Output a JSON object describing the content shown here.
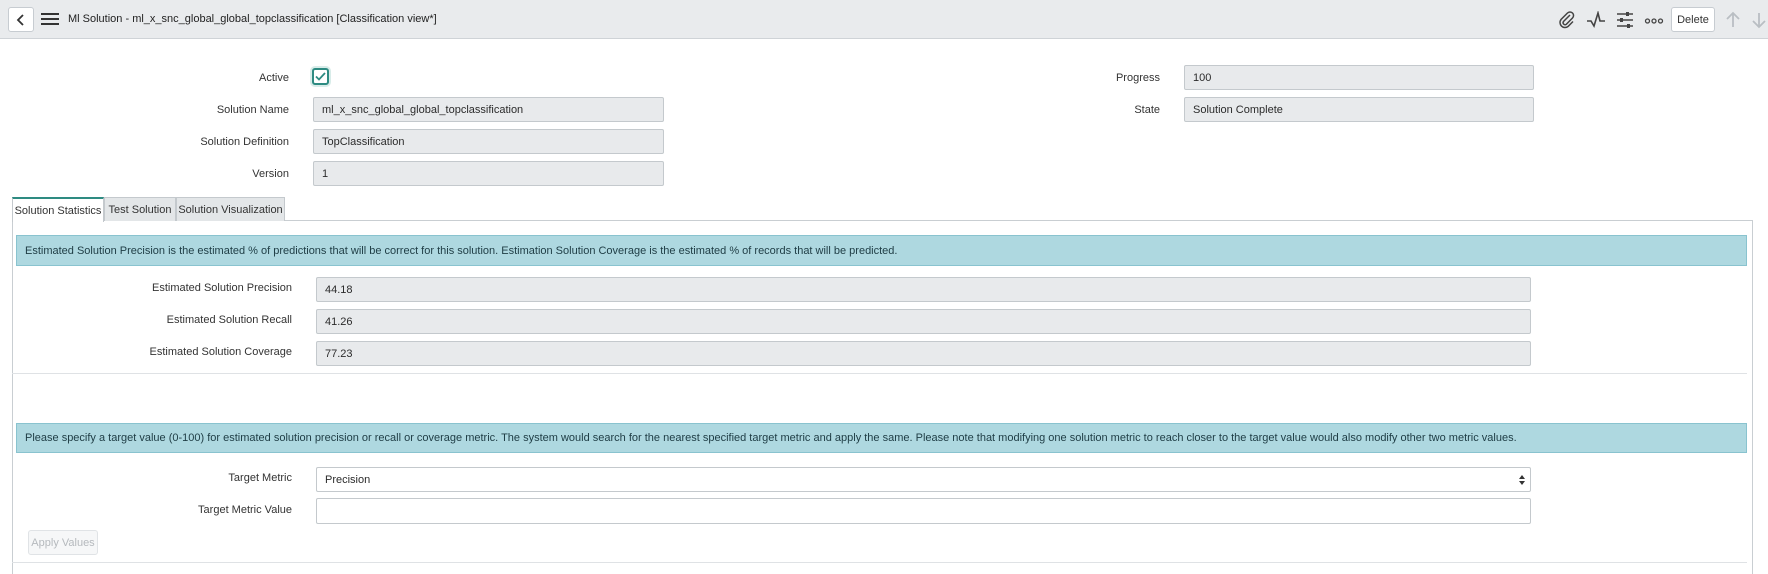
{
  "header": {
    "title": "Ml Solution - ml_x_snc_global_global_topclassification [Classification view*]",
    "delete_label": "Delete"
  },
  "icons": {
    "back": "chevron-left-icon",
    "menu": "hamburger-icon",
    "attachment": "paperclip-icon",
    "activity": "pulse-icon",
    "settings": "sliders-icon",
    "more": "ellipsis-icon",
    "prev": "arrow-up-icon",
    "next": "arrow-down-icon"
  },
  "form": {
    "active_label": "Active",
    "active_checked": true,
    "solution_name_label": "Solution Name",
    "solution_name_value": "ml_x_snc_global_global_topclassification",
    "solution_definition_label": "Solution Definition",
    "solution_definition_value": "TopClassification",
    "version_label": "Version",
    "version_value": "1",
    "progress_label": "Progress",
    "progress_value": "100",
    "state_label": "State",
    "state_value": "Solution Complete"
  },
  "tabs": [
    {
      "label": "Solution Statistics",
      "active": true
    },
    {
      "label": "Test Solution",
      "active": false
    },
    {
      "label": "Solution Visualization",
      "active": false
    }
  ],
  "statistics": {
    "info": "Estimated Solution Precision is the estimated % of predictions that will be correct for this solution. Estimation Solution Coverage is the estimated % of records that will be predicted.",
    "precision_label": "Estimated Solution Precision",
    "precision_value": "44.18",
    "recall_label": "Estimated Solution Recall",
    "recall_value": "41.26",
    "coverage_label": "Estimated Solution Coverage",
    "coverage_value": "77.23"
  },
  "target": {
    "info": "Please specify a target value (0-100) for estimated solution precision or recall or coverage metric. The system would search for the nearest specified target metric and apply the same. Please note that modifying one solution metric to reach closer to the target value would also modify other two metric values.",
    "metric_label": "Target Metric",
    "metric_selected": "Precision",
    "value_label": "Target Metric Value",
    "value_current": "",
    "apply_label": "Apply Values"
  },
  "colors": {
    "accent": "#2e8b82",
    "info_bg": "#aed8e0"
  }
}
